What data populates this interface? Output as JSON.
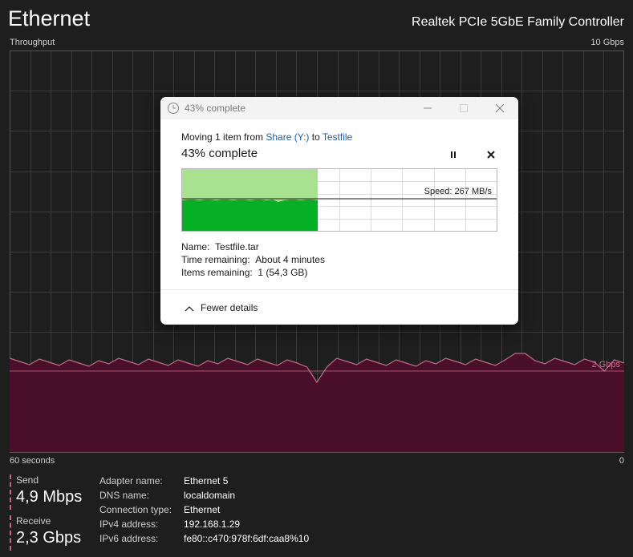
{
  "header": {
    "title": "Ethernet",
    "adapter": "Realtek PCIe 5GbE Family Controller"
  },
  "graph": {
    "y_label": "Throughput",
    "y_max_label": "10 Gbps",
    "marker_label": "2 Gbps",
    "x_left_label": "60 seconds",
    "x_right_label": "0",
    "colors": {
      "grid": "#3c3c3c",
      "line": "#c8668a",
      "fill": "#4a1029"
    }
  },
  "stats": {
    "send": {
      "label": "Send",
      "value": "4,9 Mbps"
    },
    "receive": {
      "label": "Receive",
      "value": "2,3 Gbps"
    }
  },
  "info": [
    {
      "key": "Adapter name:",
      "value": "Ethernet 5"
    },
    {
      "key": "DNS name:",
      "value": "localdomain"
    },
    {
      "key": "Connection type:",
      "value": "Ethernet"
    },
    {
      "key": "IPv4 address:",
      "value": "192.168.1.29"
    },
    {
      "key": "IPv6 address:",
      "value": "fe80::c470:978f:6df:caa8%10"
    }
  ],
  "dialog": {
    "title": "43% complete",
    "moving_prefix": "Moving 1 item from ",
    "source": "Share (Y:)",
    "to_word": " to ",
    "destination": "Testfile",
    "progress_title": "43% complete",
    "progress_fraction": 0.43,
    "speed": "Speed: 267 MB/s",
    "name_label": "Name:",
    "name_value": "Testfile.tar",
    "time_label": "Time remaining:",
    "time_value": "About 4 minutes",
    "items_label": "Items remaining:",
    "items_value": "1 (54,3 GB)",
    "fewer_details": "Fewer details",
    "icons": {
      "title": "clock-icon",
      "pause": "pause-icon",
      "cancel": "close-icon",
      "collapse": "chevron-up-icon"
    },
    "colors": {
      "progress_light": "#a8e28e",
      "progress_dark": "#06b025",
      "link": "#1a5fb4"
    }
  }
}
